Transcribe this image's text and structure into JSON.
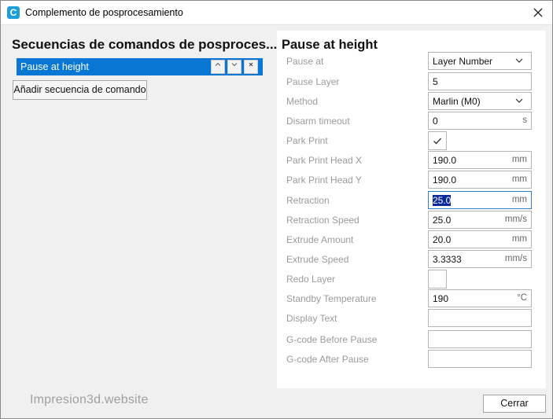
{
  "window": {
    "title": "Complemento de posprocesamiento",
    "app_icon_letter": "C"
  },
  "left": {
    "title": "Secuencias de comandos de posproces...",
    "scripts": [
      {
        "label": "Pause at height"
      }
    ],
    "up_glyph": "^",
    "down_glyph": "⌄",
    "remove_glyph": "×",
    "add_button": "Añadir secuencia de comando"
  },
  "panel": {
    "title": "Pause at height",
    "settings": [
      {
        "label": "Pause at",
        "type": "select",
        "value": "Layer Number"
      },
      {
        "label": "Pause Layer",
        "type": "text",
        "value": "5",
        "unit": ""
      },
      {
        "label": "Method",
        "type": "select",
        "value": "Marlin (M0)"
      },
      {
        "label": "Disarm timeout",
        "type": "text",
        "value": "0",
        "unit": "s"
      },
      {
        "label": "Park Print",
        "type": "checkbox",
        "checked": true
      },
      {
        "label": "Park Print Head X",
        "type": "text",
        "value": "190.0",
        "unit": "mm"
      },
      {
        "label": "Park Print Head Y",
        "type": "text",
        "value": "190.0",
        "unit": "mm"
      },
      {
        "label": "Retraction",
        "type": "text",
        "value": "25.0",
        "unit": "mm",
        "focused": true
      },
      {
        "label": "Retraction Speed",
        "type": "text",
        "value": "25.0",
        "unit": "mm/s"
      },
      {
        "label": "Extrude Amount",
        "type": "text",
        "value": "20.0",
        "unit": "mm"
      },
      {
        "label": "Extrude Speed",
        "type": "text",
        "value": "3.3333",
        "unit": "mm/s"
      },
      {
        "label": "Redo Layer",
        "type": "checkbox",
        "checked": false
      },
      {
        "label": "Standby Temperature",
        "type": "text",
        "value": "190",
        "unit": "°C"
      },
      {
        "label": "Display Text",
        "type": "text",
        "value": "",
        "unit": ""
      },
      {
        "label": "G-code Before Pause",
        "type": "text",
        "value": "",
        "unit": ""
      },
      {
        "label": "G-code After Pause",
        "type": "text",
        "value": "",
        "unit": ""
      }
    ]
  },
  "footer": {
    "watermark": "Impresion3d.website",
    "close_button": "Cerrar"
  },
  "colors": {
    "accent": "#0877d4",
    "selection": "#0a2a9a",
    "label_gray": "#9b9b9b"
  }
}
